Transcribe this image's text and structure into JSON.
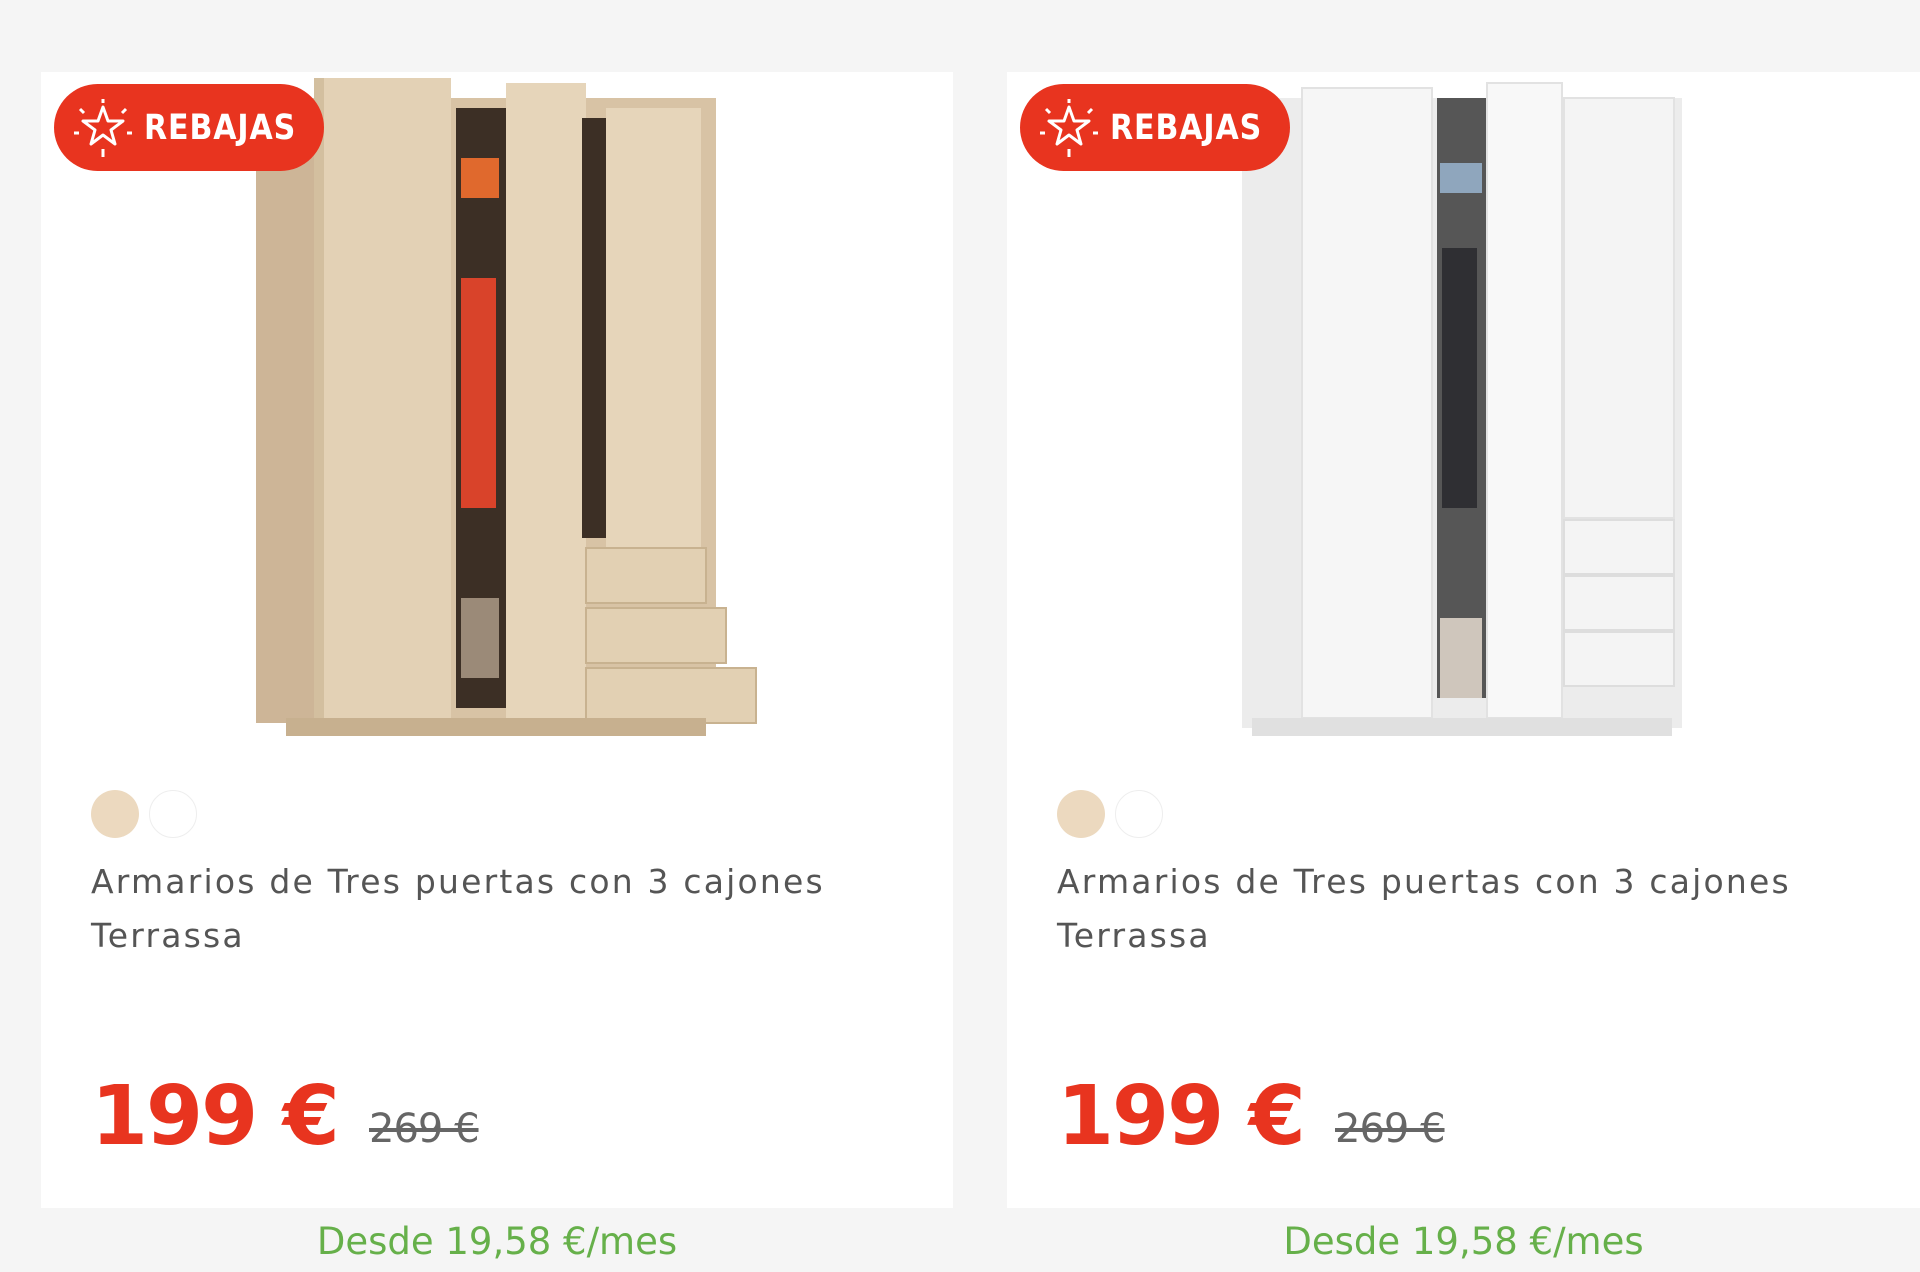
{
  "products": [
    {
      "badge": "REBAJAS",
      "color_swatches": [
        "#ecd9bf",
        "#ffffff"
      ],
      "title": "Armarios de Tres puertas con 3 cajones Terrassa",
      "price": "199 €",
      "old_price": "269 €",
      "financing": "Desde 19,58 €/mes"
    },
    {
      "badge": "REBAJAS",
      "color_swatches": [
        "#ecd9bf",
        "#ffffff"
      ],
      "title": "Armarios de Tres puertas con 3 cajones Terrassa",
      "price": "199 €",
      "old_price": "269 €",
      "financing": "Desde 19,58 €/mes"
    }
  ],
  "colors": {
    "background": "#f5f5f5",
    "card": "#ffffff",
    "accent_red": "#e8341f",
    "financing_green": "#66b04a",
    "text": "#555555"
  },
  "icons": {
    "badge_icon": "sparkle-star-icon"
  }
}
